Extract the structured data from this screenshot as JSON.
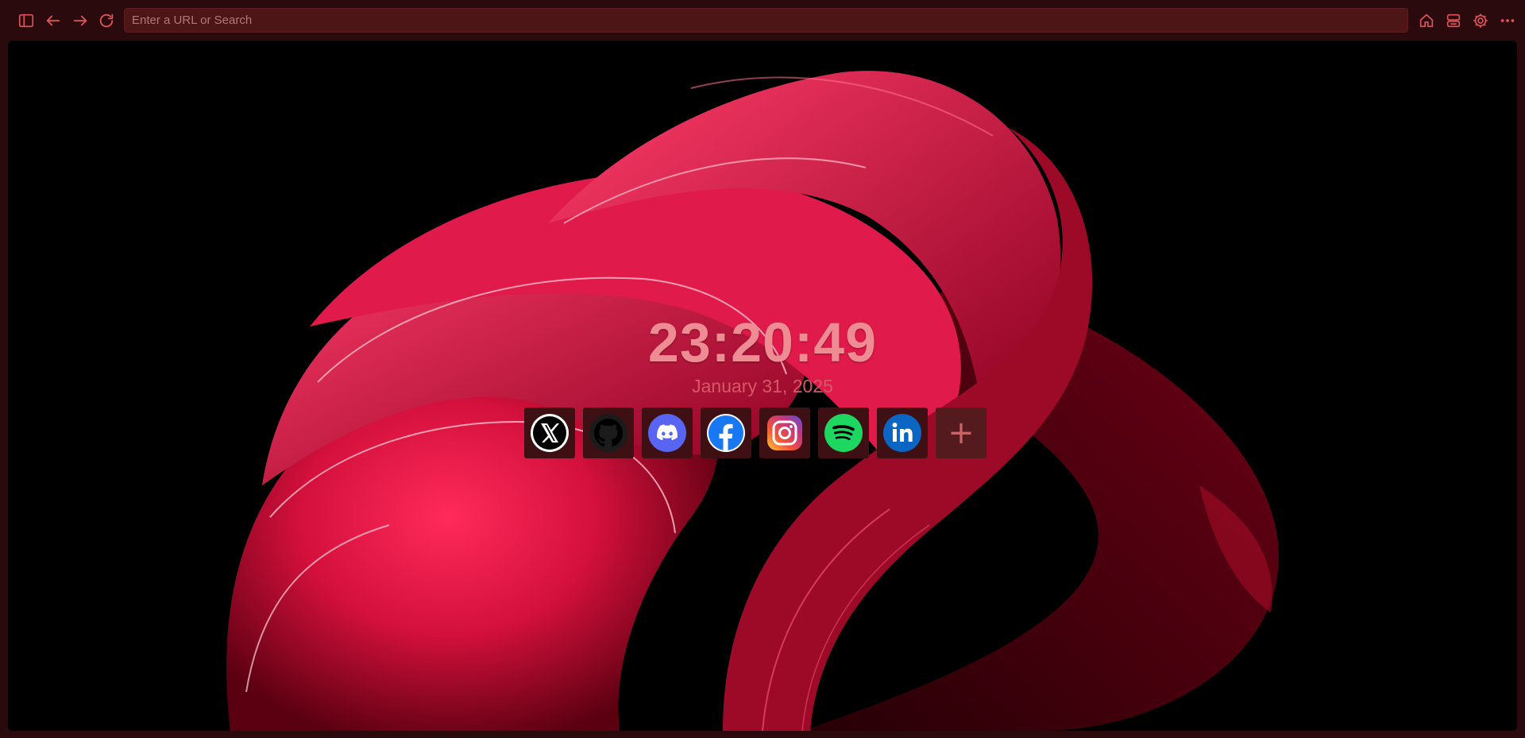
{
  "browser": {
    "url_placeholder": "Enter a URL or Search",
    "url_value": "",
    "colors": {
      "chrome": "#2a0a0c",
      "urlbar": "#4e1517",
      "icon": "#e0545c"
    },
    "toolbar_left_icons": [
      "sidebar-toggle-icon",
      "back-arrow-icon",
      "forward-arrow-icon",
      "reload-icon"
    ],
    "toolbar_right_icons": [
      "home-icon",
      "tab-overview-icon",
      "gear-icon",
      "more-dots-icon"
    ]
  },
  "newtab": {
    "time": "23:20:49",
    "date": "January 31, 2025",
    "shortcuts": [
      {
        "name": "X",
        "icon": "x-logo-icon"
      },
      {
        "name": "GitHub",
        "icon": "github-logo-icon"
      },
      {
        "name": "Discord",
        "icon": "discord-logo-icon"
      },
      {
        "name": "Facebook",
        "icon": "facebook-logo-icon"
      },
      {
        "name": "Instagram",
        "icon": "instagram-logo-icon"
      },
      {
        "name": "Spotify",
        "icon": "spotify-logo-icon"
      },
      {
        "name": "LinkedIn",
        "icon": "linkedin-logo-icon"
      }
    ],
    "add_shortcut_label": "+",
    "colors": {
      "clock": "#ef8b93",
      "date": "#d55866",
      "tile": "#3f1013",
      "add_tile": "#541a1d"
    }
  }
}
